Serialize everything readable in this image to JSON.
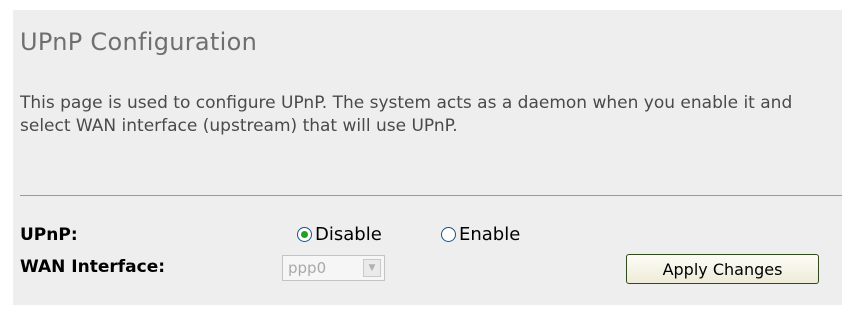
{
  "page": {
    "title": "UPnP Configuration",
    "description": "This page is used to configure UPnP. The system acts as a daemon when you enable it and select WAN interface (upstream) that will use UPnP."
  },
  "form": {
    "upnp_label": "UPnP:",
    "upnp_options": [
      {
        "label": "Disable",
        "checked": true
      },
      {
        "label": "Enable",
        "checked": false
      }
    ],
    "wan_label": "WAN Interface:",
    "wan_select": {
      "value": "ppp0",
      "disabled": true
    },
    "apply_button": "Apply Changes"
  },
  "colors": {
    "panel_bg": "#eeeeee",
    "title": "#6f6f6f",
    "radio_checked": "#21a121"
  },
  "icons": {
    "select_arrow": "chevron-down-icon"
  }
}
